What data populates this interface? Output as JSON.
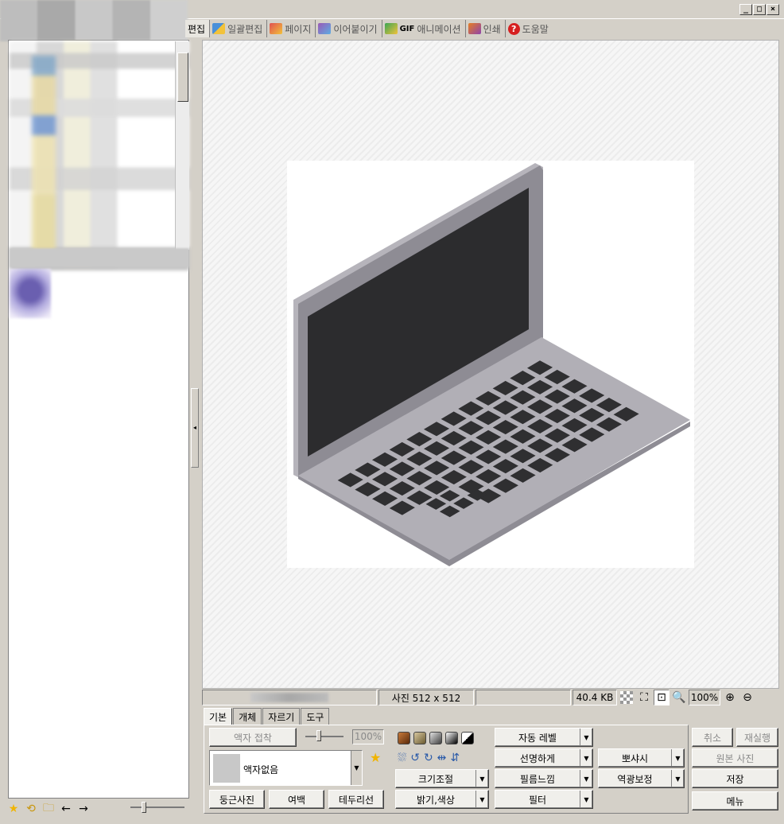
{
  "window": {
    "minimize": "_",
    "maximize": "□",
    "close": "×"
  },
  "menu_tabs": [
    {
      "label": "편집",
      "icon": "edit-icon"
    },
    {
      "label": "일괄편집",
      "icon": "batch-edit-icon"
    },
    {
      "label": "페이지",
      "icon": "page-icon"
    },
    {
      "label": "이어붙이기",
      "icon": "concat-icon"
    },
    {
      "label": "애니메이션",
      "prefix": "GIF",
      "icon": "gif-icon"
    },
    {
      "label": "인쇄",
      "icon": "print-icon"
    },
    {
      "label": "도움말",
      "icon": "help-icon"
    }
  ],
  "status": {
    "dimensions": "사진 512 x 512",
    "filesize": "40.4 KB",
    "zoom": "100%"
  },
  "bottom_tabs": [
    "기본",
    "개체",
    "자르기",
    "도구"
  ],
  "tools": {
    "frame_compose": "액자 접착",
    "frame_percent": "100%",
    "frame_select": "액자없음",
    "round_photo": "둥근사진",
    "margin": "여백",
    "border_line": "테두리선",
    "resize": "크기조절",
    "brightness": "밝기,색상",
    "auto_level": "자동 레벨",
    "sharpen": "선명하게",
    "film": "필름느낌",
    "filter": "필터",
    "soft": "뽀샤시",
    "backlight": "역광보정"
  },
  "actions": {
    "undo": "취소",
    "redo": "재실행",
    "original": "원본 사진",
    "save": "저장",
    "menu": "메뉴"
  },
  "colors": {
    "laptop_body": "#b1afb6",
    "laptop_lid": "#8e8c94",
    "screen": "#2c2c2e",
    "keys": "#2f2f31"
  }
}
